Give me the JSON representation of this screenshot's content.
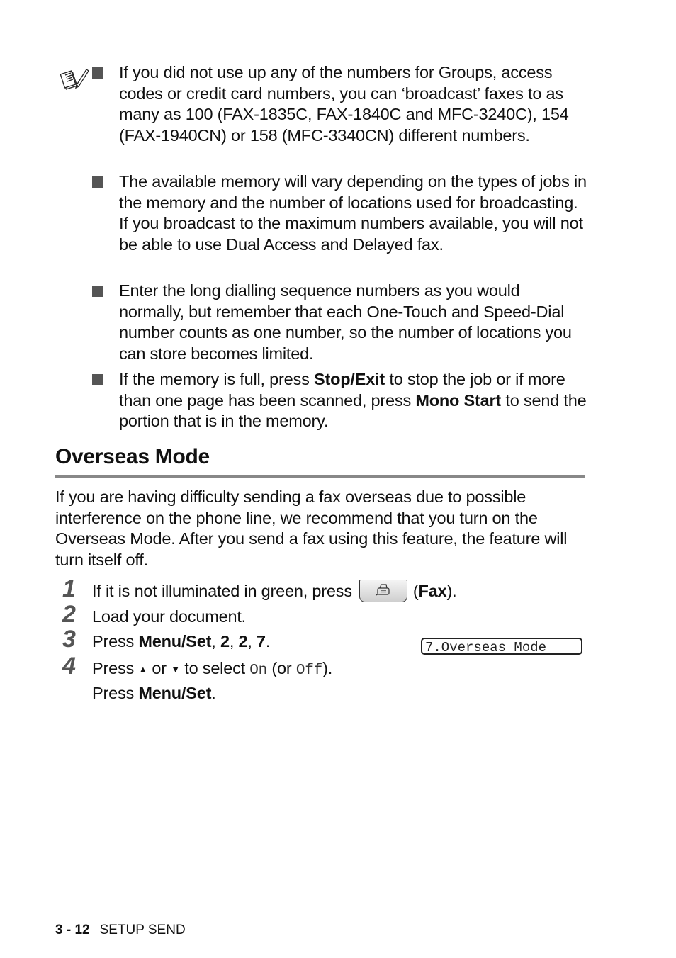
{
  "notes": {
    "icon": "notepad-pencil-icon",
    "items": [
      {
        "parts": [
          {
            "t": "If you did not use up any of the numbers for Groups, access codes or credit card numbers, you can ‘broadcast’ faxes to as many as 100 (FAX-1835C, FAX-1840C and MFC-3240C), 154 (FAX-1940CN) or 158 (MFC-3340CN) different numbers."
          }
        ]
      },
      {
        "parts": [
          {
            "t": "The available memory will vary depending on the types of jobs in the memory and the number of locations used for broadcasting. If you broadcast to the maximum numbers available, you will not be able to use Dual Access and Delayed fax."
          }
        ]
      },
      {
        "parts": [
          {
            "t": "Enter the long dialling sequence numbers as you would normally, but remember that each One-Touch and Speed-Dial number counts as one number, so the number of locations you can store becomes limited."
          }
        ]
      },
      {
        "parts": [
          {
            "t": "If the memory is full, press "
          },
          {
            "t": "Stop/Exit",
            "b": true
          },
          {
            "t": " to stop the job or if more than one page has been scanned, press "
          },
          {
            "t": "Mono Start",
            "b": true
          },
          {
            "t": " to send the portion that is in the memory."
          }
        ]
      }
    ]
  },
  "section": {
    "title": "Overseas Mode",
    "intro": "If you are having difficulty sending a fax overseas due to possible interference on the phone line, we recommend that you turn on the Overseas Mode. After you send a fax using this feature, the feature will turn itself off."
  },
  "steps": [
    {
      "num": "1",
      "a": "If it is not illuminated in green, press",
      "btn_icon": "fax-button-icon",
      "b_open": "(",
      "b_bold": "Fax",
      "b_close": ")."
    },
    {
      "num": "2",
      "text": "Load your document."
    },
    {
      "num": "3",
      "press": "Press ",
      "menu": "Menu/Set",
      "sep1": ", ",
      "k1": "2",
      "sep2": ", ",
      "k2": "2",
      "sep3": ", ",
      "k3": "7",
      "end": "."
    },
    {
      "num": "4",
      "press": "Press ",
      "up": "▲",
      "or": " or ",
      "down": "▼",
      "select": " to select ",
      "on": "On",
      "paren_open": " (or ",
      "off": "Off",
      "paren_close": ").",
      "line2_press": "Press ",
      "line2_menu": "Menu/Set",
      "line2_end": "."
    }
  ],
  "lcd": {
    "text": "7.Overseas Mode"
  },
  "footer": {
    "page": "3 - 12",
    "chapter": "SETUP SEND"
  }
}
